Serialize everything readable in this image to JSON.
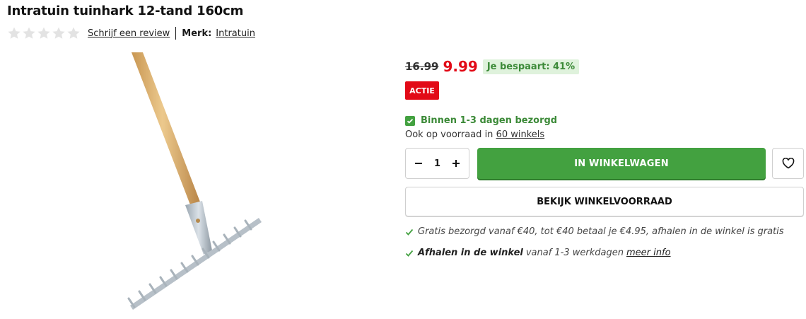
{
  "product": {
    "title": "Intratuin tuinhark 12-tand 160cm",
    "rating_stars": 0,
    "review_link": "Schrijf een review",
    "brand_label": "Merk:",
    "brand_name": "Intratuin"
  },
  "price": {
    "old": "16.99",
    "new": "9.99",
    "savings": "Je bespaart: 41%",
    "badge": "ACTIE"
  },
  "availability": {
    "delivery": "Binnen 1-3 dagen bezorgd",
    "stock_prefix": "Ook op voorraad in",
    "stock_link": "60 winkels"
  },
  "purchase": {
    "quantity": "1",
    "add_to_cart": "IN WINKELWAGEN",
    "store_stock": "BEKIJK WINKELVOORRAAD"
  },
  "usps": {
    "shipping": "Gratis bezorgd vanaf €40, tot €40 betaal je €4.95, afhalen in de winkel is gratis",
    "pickup_strong": "Afhalen in de winkel",
    "pickup_rest": "vanaf 1-3 werkdagen",
    "pickup_link": "meer info"
  },
  "colors": {
    "accent_green": "#43a140",
    "sale_red": "#e20a17",
    "savings_bg": "#dff2dc"
  },
  "icons": [
    "star-icon",
    "checkbox-checked-icon",
    "minus-icon",
    "plus-icon",
    "heart-icon",
    "check-icon"
  ]
}
